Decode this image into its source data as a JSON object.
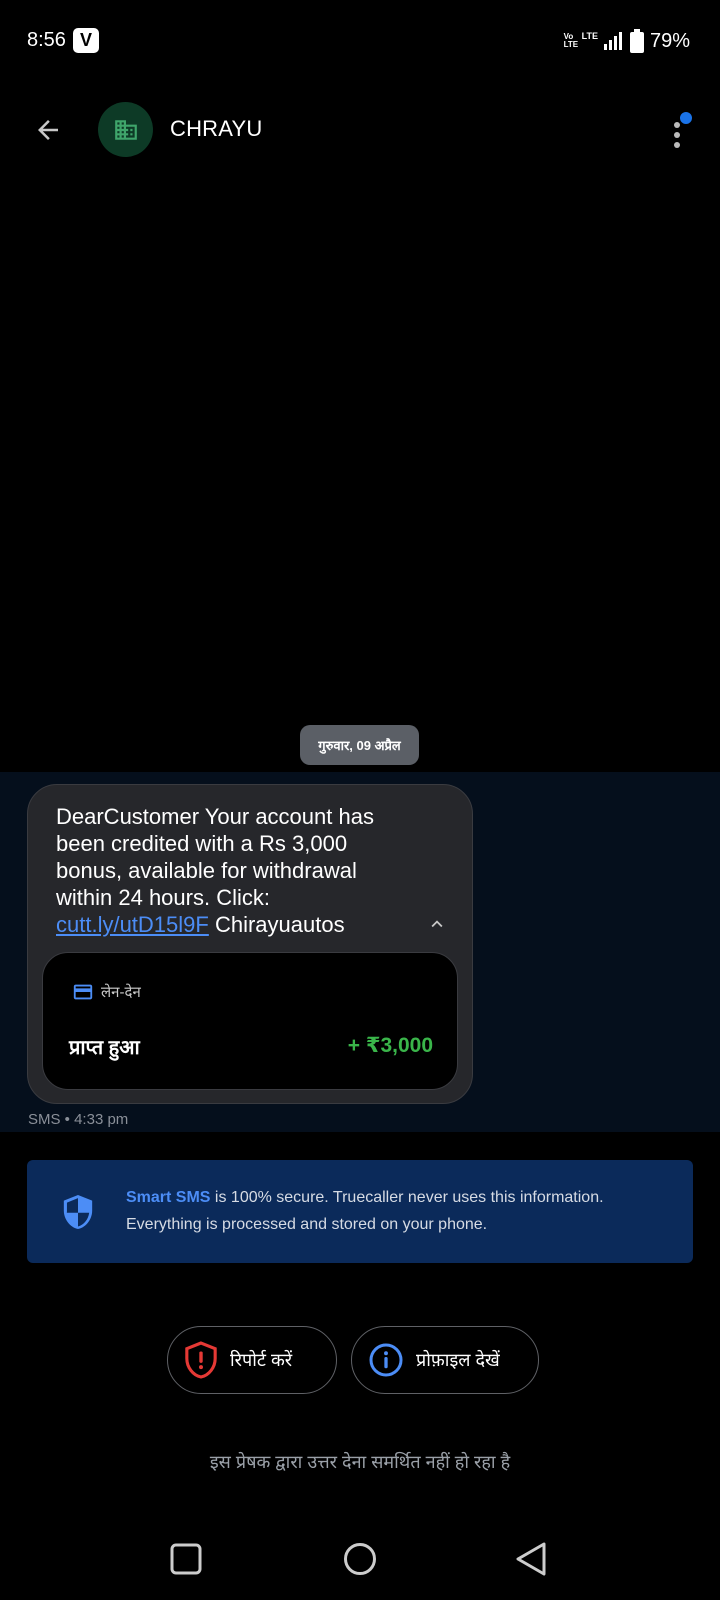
{
  "status_bar": {
    "time": "8:56",
    "app_icon_letter": "V",
    "volte": "Vo LTE",
    "network": "LTE",
    "battery": "79%"
  },
  "header": {
    "contact_name": "CHRAYU",
    "back_icon": "arrow-left-icon",
    "avatar_icon": "building-icon",
    "menu_icon": "more-vert-icon"
  },
  "conversation": {
    "date_label": "गुरुवार, 09 अप्रैल",
    "message": {
      "text_before_link": "DearCustomer Your account has been credited with a Rs 3,000 bonus, available for withdrawal within 24 hours. Click: ",
      "link_text": "cutt.ly/utD15l9F",
      "text_after_link": " Chirayuautos",
      "meta": "SMS • 4:33 pm"
    },
    "transaction": {
      "category": "लेन-देन",
      "label": "प्राप्त हुआ",
      "amount": "+ ₹3,000"
    }
  },
  "info_banner": {
    "highlight": "Smart SMS",
    "text": " is 100% secure. Truecaller never uses this information. Everything is processed and stored on your phone."
  },
  "actions": {
    "report_label": "रिपोर्ट करें",
    "profile_label": "प्रोफ़ाइल देखें"
  },
  "reply_note": "इस प्रेषक द्वारा उत्तर देना समर्थित नहीं हो रहा है",
  "colors": {
    "accent_blue": "#4c8df6",
    "amount_green": "#3ab54a",
    "report_red": "#e53935",
    "banner_bg": "#0b2a5a"
  }
}
